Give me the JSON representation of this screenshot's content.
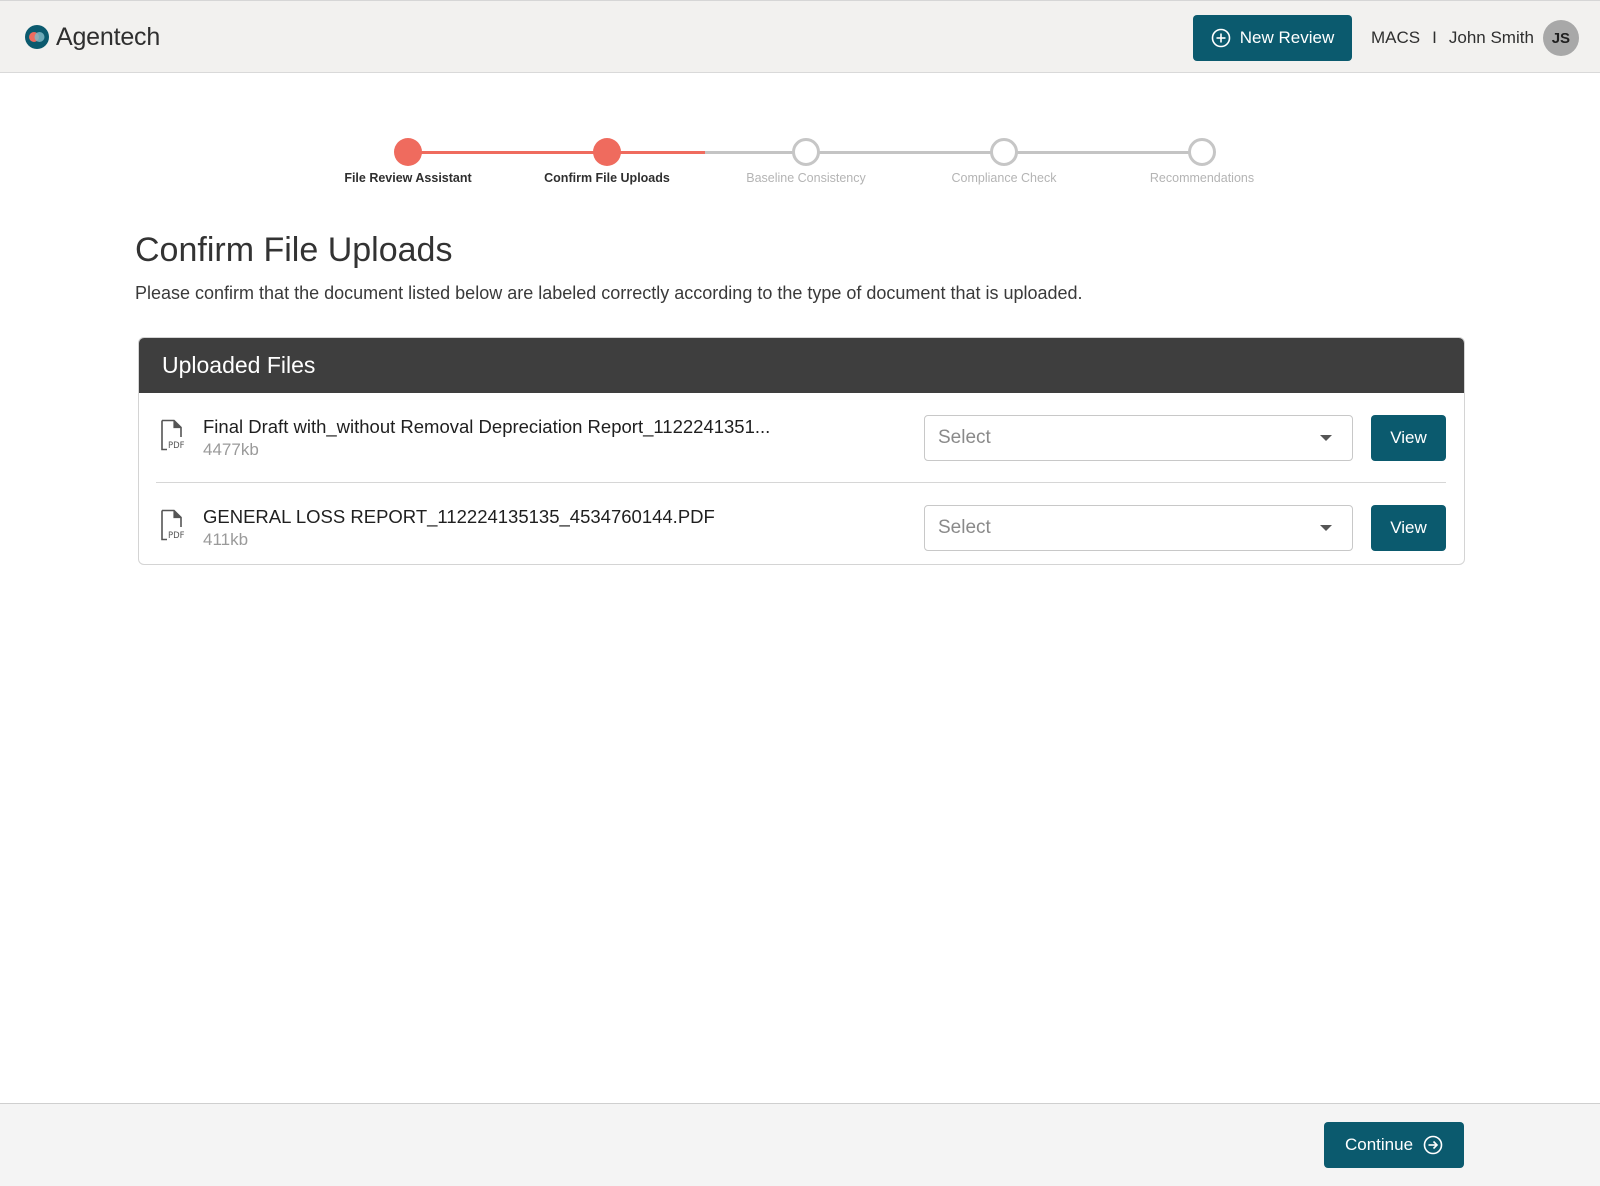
{
  "header": {
    "brand": "Agentech",
    "new_review_label": "New Review",
    "org": "MACS",
    "separator": "I",
    "user_name": "John Smith",
    "user_initials": "JS"
  },
  "stepper": {
    "steps": [
      {
        "label": "File Review Assistant",
        "state": "done"
      },
      {
        "label": "Confirm File Uploads",
        "state": "done"
      },
      {
        "label": "Baseline Consistency",
        "state": "todo"
      },
      {
        "label": "Compliance Check",
        "state": "todo"
      },
      {
        "label": "Recommendations",
        "state": "todo"
      }
    ]
  },
  "main": {
    "title": "Confirm File Uploads",
    "subtitle": "Please confirm that the document listed below are labeled correctly according to the type of document that is uploaded."
  },
  "files": {
    "heading": "Uploaded Files",
    "icon_label": "PDF",
    "items": [
      {
        "name": "Final Draft with_without Removal Depreciation Report_1122241351...",
        "size": "4477kb",
        "select_value": "Select",
        "view_label": "View"
      },
      {
        "name": "GENERAL LOSS REPORT_112224135135_4534760144.PDF",
        "size": "411kb",
        "select_value": "Select",
        "view_label": "View"
      }
    ]
  },
  "footer": {
    "continue_label": "Continue"
  },
  "colors": {
    "primary": "#0b5a6e",
    "progress_done": "#ef6b5e",
    "progress_todo": "#c4c4c4",
    "card_header": "#3e3e3e"
  },
  "icons": {
    "brand": "agentech-logo-icon",
    "new_review": "plus-circle-icon",
    "file": "pdf-file-icon",
    "dropdown": "caret-down-icon",
    "continue": "arrow-right-circle-icon"
  }
}
